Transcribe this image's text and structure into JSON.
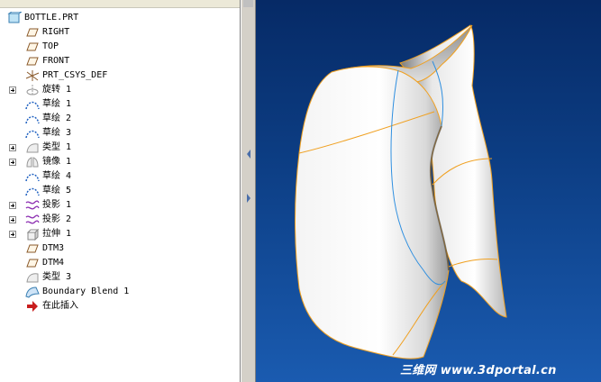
{
  "model_tree": {
    "root": {
      "label": "BOTTLE.PRT",
      "icon": "part-icon"
    },
    "items": [
      {
        "label": "RIGHT",
        "icon": "datum-plane-icon",
        "expandable": false
      },
      {
        "label": "TOP",
        "icon": "datum-plane-icon",
        "expandable": false
      },
      {
        "label": "FRONT",
        "icon": "datum-plane-icon",
        "expandable": false
      },
      {
        "label": "PRT_CSYS_DEF",
        "icon": "coordinate-system-icon",
        "expandable": false
      },
      {
        "label": "旋转 1",
        "icon": "revolve-icon",
        "expandable": true
      },
      {
        "label": "草绘 1",
        "icon": "sketch-icon",
        "expandable": false
      },
      {
        "label": "草绘 2",
        "icon": "sketch-icon",
        "expandable": false
      },
      {
        "label": "草绘 3",
        "icon": "sketch-icon",
        "expandable": false
      },
      {
        "label": "类型 1",
        "icon": "surface-type-icon",
        "expandable": true
      },
      {
        "label": "镜像 1",
        "icon": "mirror-icon",
        "expandable": true
      },
      {
        "label": "草绘 4",
        "icon": "sketch-icon",
        "expandable": false
      },
      {
        "label": "草绘 5",
        "icon": "sketch-icon",
        "expandable": false
      },
      {
        "label": "投影 1",
        "icon": "projection-icon",
        "expandable": true
      },
      {
        "label": "投影 2",
        "icon": "projection-icon",
        "expandable": true
      },
      {
        "label": "拉伸 1",
        "icon": "extrude-icon",
        "expandable": true
      },
      {
        "label": "DTM3",
        "icon": "datum-plane-icon",
        "expandable": false
      },
      {
        "label": "DTM4",
        "icon": "datum-plane-icon",
        "expandable": false
      },
      {
        "label": "类型 3",
        "icon": "surface-type-icon",
        "expandable": false
      },
      {
        "label": "Boundary Blend 1",
        "icon": "boundary-blend-icon",
        "expandable": false
      },
      {
        "label": "在此插入",
        "icon": "insert-here-arrow-icon",
        "expandable": false
      }
    ]
  },
  "viewport": {
    "watermark": "三维网 www.3dportal.cn",
    "background_top": "#062a66",
    "background_bottom": "#1a5bb0",
    "edge_color": "#f0a020",
    "curve_color": "#2f8fe0"
  }
}
